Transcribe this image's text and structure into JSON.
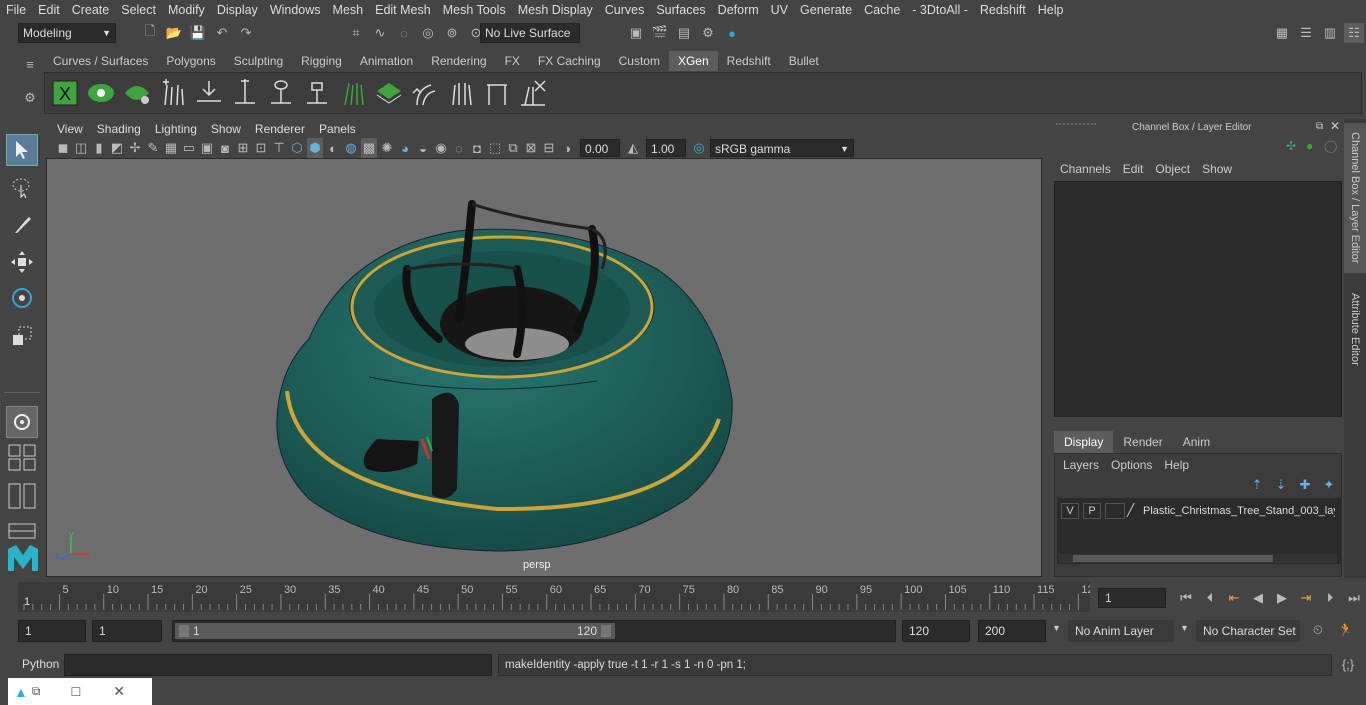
{
  "menubar": [
    "File",
    "Edit",
    "Create",
    "Select",
    "Modify",
    "Display",
    "Windows",
    "Mesh",
    "Edit Mesh",
    "Mesh Tools",
    "Mesh Display",
    "Curves",
    "Surfaces",
    "Deform",
    "UV",
    "Generate",
    "Cache",
    "- 3DtoAll -",
    "Redshift",
    "Help"
  ],
  "statusline": {
    "mode": "Modeling",
    "live_surface": "No Live Surface"
  },
  "shelf_tabs": [
    "Curves / Surfaces",
    "Polygons",
    "Sculpting",
    "Rigging",
    "Animation",
    "Rendering",
    "FX",
    "FX Caching",
    "Custom",
    "XGen",
    "Redshift",
    "Bullet"
  ],
  "shelf_active": "XGen",
  "viewport": {
    "menu": [
      "View",
      "Shading",
      "Lighting",
      "Show",
      "Renderer",
      "Panels"
    ],
    "exposure": "0.00",
    "gamma": "1.00",
    "color_space": "sRGB gamma",
    "camera_label": "persp",
    "axis": {
      "y": "y",
      "x": "x",
      "z": "z"
    }
  },
  "channel_box": {
    "title": "Channel Box / Layer Editor",
    "menu": [
      "Channels",
      "Edit",
      "Object",
      "Show"
    ],
    "layer_tabs": [
      "Display",
      "Render",
      "Anim"
    ],
    "layer_tab_active": "Display",
    "layer_menu": [
      "Layers",
      "Options",
      "Help"
    ],
    "layer": {
      "v": "V",
      "p": "P",
      "name": "Plastic_Christmas_Tree_Stand_003_lay"
    }
  },
  "side_tabs": [
    "Channel Box / Layer Editor",
    "Attribute Editor"
  ],
  "timeline": {
    "ticks": [
      "5",
      "10",
      "15",
      "20",
      "25",
      "30",
      "35",
      "40",
      "45",
      "50",
      "55",
      "60",
      "65",
      "70",
      "75",
      "80",
      "85",
      "90",
      "95",
      "100",
      "105",
      "110",
      "115",
      "12"
    ],
    "start_label": "1",
    "current_frame": "1"
  },
  "range": {
    "start": "1",
    "start2": "1",
    "slider_start": "1",
    "slider_end": "120",
    "end": "120",
    "end2": "200",
    "anim_layer": "No Anim Layer",
    "char_set": "No Character Set"
  },
  "cmdline": {
    "lang": "Python",
    "result": "makeIdentity -apply true -t 1 -r 1 -s 1 -n 0 -pn 1;"
  },
  "colors": {
    "accent": "#5d5d5d",
    "model_teal": "#1f5b55",
    "stripe": "#c9a53b",
    "xgen_green": "#3fa33f"
  }
}
